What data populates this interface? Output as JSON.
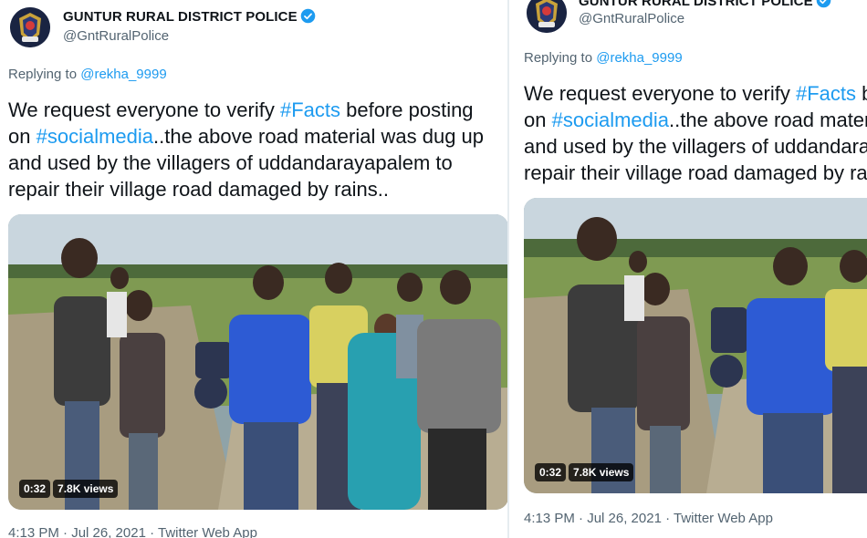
{
  "tweet": {
    "account_name": "GUNTUR RURAL DISTRICT POLICE",
    "handle": "@GntRuralPolice",
    "replying_prefix": "Replying to",
    "replying_handle": "@rekha_9999",
    "text": {
      "line1_a": "We request everyone to verify",
      "line1_tag": "#Facts",
      "line1_b": " before posting",
      "line2_a": "on",
      "line2_tag": "#socialmedia",
      "line2_b": "..the above road material was dug up",
      "line3": "and used by the villagers of uddandarayapalem to",
      "line4": "repair their village road damaged by rains.."
    },
    "video": {
      "duration": "0:32",
      "views": "7.8K views"
    },
    "timestamp": "4:13 PM · Jul 26, 2021 · Twitter Web App"
  },
  "colors": {
    "link": "#1d9bf0",
    "secondary_text": "#536471",
    "verified": "#1d9bf0"
  },
  "icons": {
    "avatar": "police-emblem-icon",
    "verified": "verified-badge-icon"
  }
}
